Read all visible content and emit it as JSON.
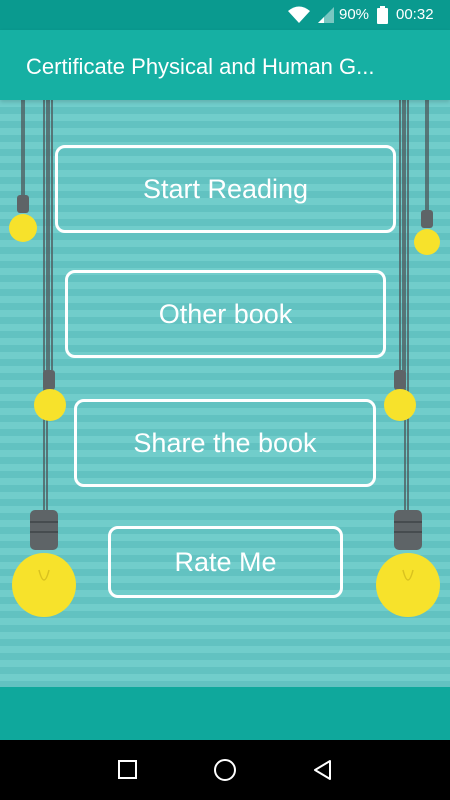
{
  "status_bar": {
    "battery": "90%",
    "time": "00:32",
    "icons": [
      "wifi-icon",
      "signal-icon",
      "battery-icon"
    ]
  },
  "app_bar": {
    "title": "Certificate Physical and Human G..."
  },
  "menu": {
    "start_reading": "Start Reading",
    "other_book": "Other book",
    "share_book": "Share the book",
    "rate_me": "Rate Me"
  },
  "nav_bar": {
    "icons": [
      "recent-apps-icon",
      "home-icon",
      "back-icon"
    ]
  },
  "colors": {
    "status_bar": "#0a9a8f",
    "app_bar": "#16b0a3",
    "stripe_light": "#71cdcb",
    "stripe_dark": "#62c2c1",
    "bulb": "#f7e22b",
    "bottom_strip": "#0fa89c"
  }
}
